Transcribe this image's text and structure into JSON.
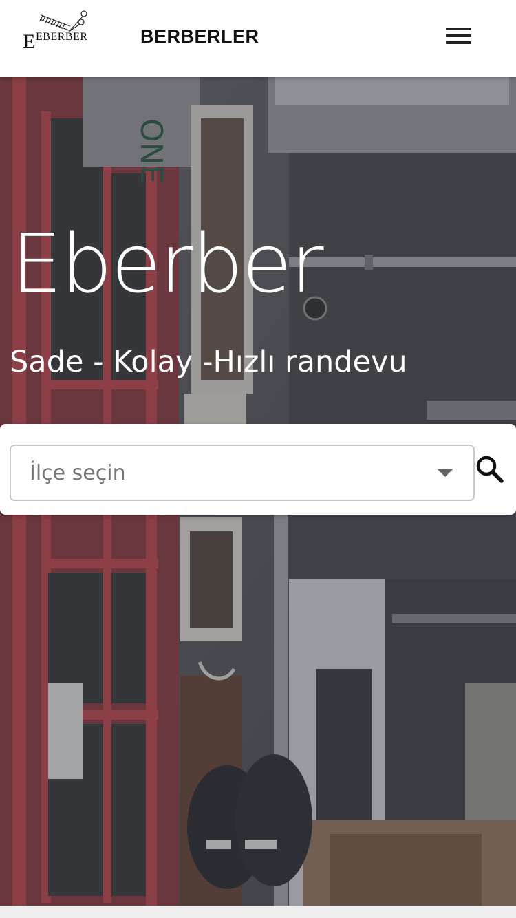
{
  "header": {
    "logo_text": "EBERBER",
    "brand": "BERBERLER",
    "menu_icon": "hamburger-menu-icon"
  },
  "hero": {
    "title": "Eberber",
    "subtitle": "Sade - Kolay -Hızlı randevu"
  },
  "search": {
    "select_placeholder": "İlçe seçin",
    "dropdown_icon": "caret-down-icon",
    "search_icon": "search-icon"
  },
  "colors": {
    "header_bg": "#ffffff",
    "accent_red": "#b0313a",
    "overlay": "#46484e"
  }
}
